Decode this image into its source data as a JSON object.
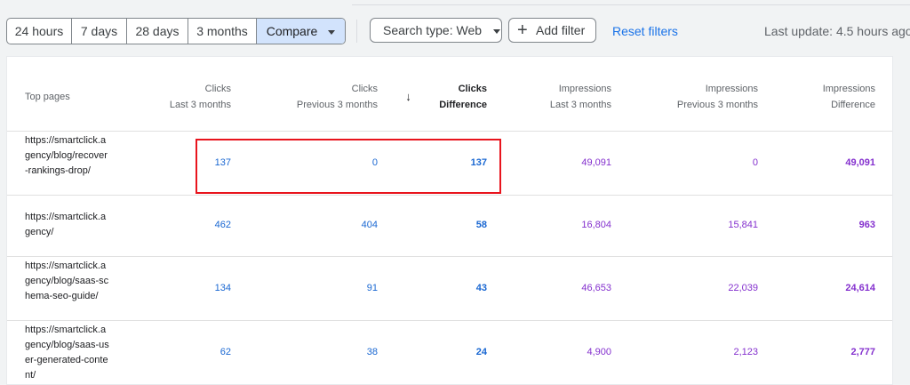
{
  "toolbar": {
    "ranges": [
      "24 hours",
      "7 days",
      "28 days",
      "3 months"
    ],
    "compare_label": "Compare",
    "search_type_label": "Search type: Web",
    "add_filter_label": "Add filter",
    "reset_label": "Reset filters",
    "last_update": "Last update: 4.5 hours ago"
  },
  "table": {
    "columns": [
      {
        "line1": "Top pages",
        "line2": ""
      },
      {
        "line1": "Clicks",
        "line2": "Last 3 months"
      },
      {
        "line1": "Clicks",
        "line2": "Previous 3 months"
      },
      {
        "line1": "Clicks",
        "line2": "Difference"
      },
      {
        "line1": "Impressions",
        "line2": "Last 3 months"
      },
      {
        "line1": "Impressions",
        "line2": "Previous 3 months"
      },
      {
        "line1": "Impressions",
        "line2": "Difference"
      }
    ],
    "rows": [
      {
        "url": "https://smartclick.agency/blog/recover-rankings-drop/",
        "clicks_last": "137",
        "clicks_prev": "0",
        "clicks_diff": "137",
        "imp_last": "49,091",
        "imp_prev": "0",
        "imp_diff": "49,091"
      },
      {
        "url": "https://smartclick.agency/",
        "clicks_last": "462",
        "clicks_prev": "404",
        "clicks_diff": "58",
        "imp_last": "16,804",
        "imp_prev": "15,841",
        "imp_diff": "963"
      },
      {
        "url": "https://smartclick.agency/blog/saas-schema-seo-guide/",
        "clicks_last": "134",
        "clicks_prev": "91",
        "clicks_diff": "43",
        "imp_last": "46,653",
        "imp_prev": "22,039",
        "imp_diff": "24,614"
      },
      {
        "url": "https://smartclick.agency/blog/saas-user-generated-content/",
        "clicks_last": "62",
        "clicks_prev": "38",
        "clicks_diff": "24",
        "imp_last": "4,900",
        "imp_prev": "2,123",
        "imp_diff": "2,777"
      }
    ]
  },
  "colors": {
    "clicks": "#1967d2",
    "impressions": "#8430ce",
    "highlight": "#e8141d",
    "link": "#1a73e8"
  }
}
